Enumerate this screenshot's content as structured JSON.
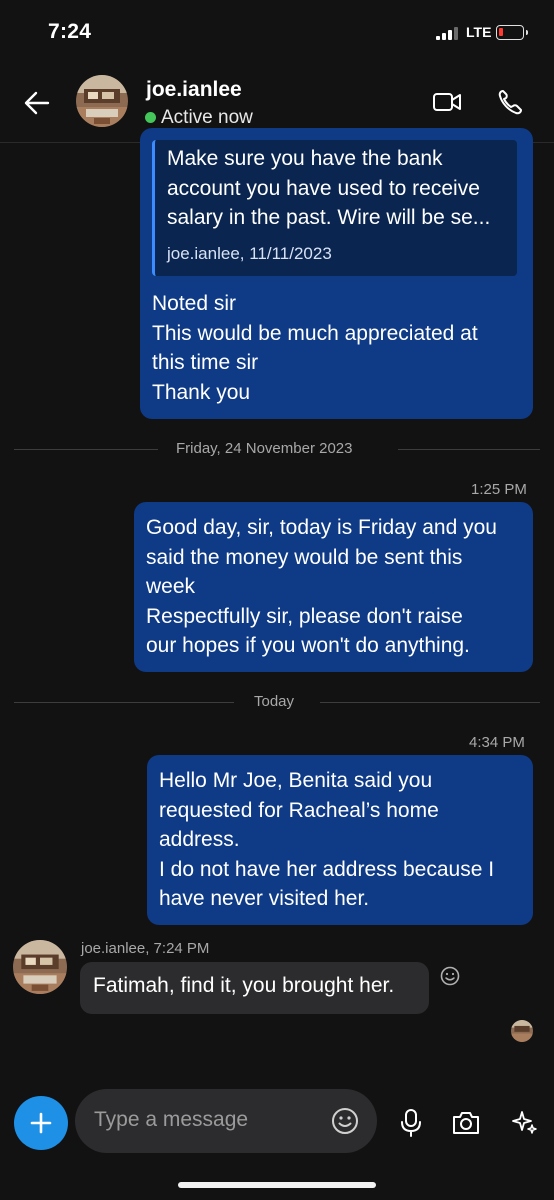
{
  "status_bar": {
    "time": "7:24",
    "network": "LTE"
  },
  "header": {
    "name": "joe.ianlee",
    "status": "Active now"
  },
  "messages": {
    "m1": {
      "quote_text": "Make sure you have the bank\naccount you have used to receive\nsalary in the past. Wire will be se...",
      "quote_meta": "joe.ianlee, 11/11/2023",
      "text": "Noted sir\nThis would be much appreciated at\nthis time sir\nThank you"
    },
    "divider1": "Friday, 24 November 2023",
    "m2": {
      "time": "1:25 PM",
      "text": "Good day, sir, today is Friday and you\nsaid the money would be sent this\nweek\nRespectfully sir, please don't raise\nour hopes if you won't do anything."
    },
    "divider2": "Today",
    "m3": {
      "time": "4:34 PM",
      "text": "Hello Mr Joe, Benita said you\nrequested for Racheal’s home\naddress.\nI do not have her address because I\nhave never visited her."
    },
    "m4": {
      "meta": "joe.ianlee, 7:24 PM",
      "text": "Fatimah, find it, you brought her."
    }
  },
  "composer": {
    "placeholder": "Type a message"
  },
  "icons": [
    "back-arrow-icon",
    "video-call-icon",
    "phone-icon",
    "plus-icon",
    "emoji-icon",
    "microphone-icon",
    "camera-icon",
    "sparkle-icon",
    "add-reaction-icon"
  ]
}
